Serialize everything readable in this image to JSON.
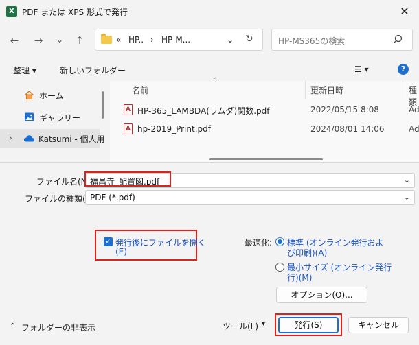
{
  "window": {
    "title": "PDF または XPS 形式で発行",
    "app_icon": "X",
    "close_glyph": "✕"
  },
  "nav": {
    "back": "←",
    "forward": "→",
    "dropdown": "⌄",
    "up": "↑",
    "address": [
      "«",
      "HP..",
      "›",
      "HP-M...",
      "⌄",
      "↻"
    ],
    "search_placeholder": "HP-MS365の検索"
  },
  "toolbar": {
    "organize": "整理 ▾",
    "new_folder": "新しいフォルダー",
    "view": "☰ ▾",
    "help": "?"
  },
  "sidebar": {
    "items": [
      {
        "label": "ホーム",
        "icon": "home-icon"
      },
      {
        "label": "ギャラリー",
        "icon": "gallery-icon"
      },
      {
        "label": "Katsumi - 個人用",
        "icon": "cloud-icon",
        "expander": "›"
      }
    ]
  },
  "file_list": {
    "sort_arrow": "⌃",
    "columns": [
      "名前",
      "更新日時",
      "種類"
    ],
    "rows": [
      {
        "name": "HP-365_LAMBDA(ラムダ)関数.pdf",
        "date": "2022/05/15 8:08",
        "type": "Ad"
      },
      {
        "name": "hp-2019_Print.pdf",
        "date": "2024/08/01 14:06",
        "type": "Ad"
      }
    ]
  },
  "form": {
    "filename_label": "ファイル名(N):",
    "filename_value": "福昌寺_配置図.pdf",
    "filetype_label": "ファイルの種類(T):",
    "filetype_value": "PDF (*.pdf)",
    "chevron": "⌄"
  },
  "options": {
    "open_after_line1": "発行後にファイルを開く",
    "open_after_line2": "(E)",
    "open_after_checked": true,
    "optimize_label": "最適化:",
    "standard_line1": "標準 (オンライン発行およ",
    "standard_line2": "び印刷)(A)",
    "minimum_line1": "最小サイズ (オンライン発行",
    "minimum_line2": "行)(M)",
    "options_button": "オプション(O)..."
  },
  "footer": {
    "hide_folders": "フォルダーの非表示",
    "hide_arrow": "⌃",
    "tools": "ツール(L)",
    "tools_arrow": "▾",
    "publish": "発行(S)",
    "cancel": "キャンセル"
  },
  "colors": {
    "accent": "#1c6fd1",
    "highlight_border": "#e0201b",
    "pdf_icon": "#c62828",
    "excel_green": "#1f7244"
  }
}
